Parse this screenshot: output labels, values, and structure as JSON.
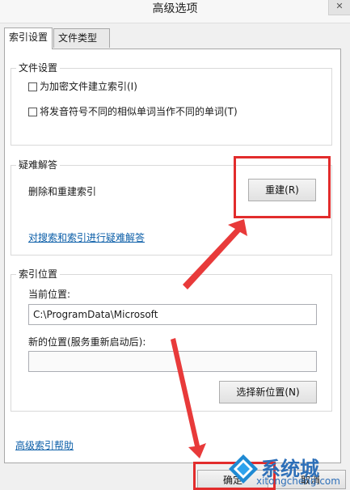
{
  "window": {
    "title": "高级选项"
  },
  "tabs": [
    {
      "label": "索引设置"
    },
    {
      "label": "文件类型"
    }
  ],
  "file_settings": {
    "title": "文件设置",
    "options": [
      {
        "label": "为加密文件建立索引(I)"
      },
      {
        "label": "将发音符号不同的相似单词当作不同的单词(T)"
      }
    ]
  },
  "troubleshoot": {
    "title": "疑难解答",
    "description": "删除和重建索引",
    "rebuild_label": "重建(R)",
    "link_label": "对搜索和索引进行疑难解答"
  },
  "index_location": {
    "title": "索引位置",
    "current_label": "当前位置:",
    "current_value": "C:\\ProgramData\\Microsoft",
    "new_label": "新的位置(服务重新启动后):",
    "new_value": "",
    "select_label": "选择新位置(N)"
  },
  "help_link": "高级索引帮助",
  "footer": {
    "ok_label": "确定",
    "cancel_label": "取消"
  },
  "watermark": {
    "text": "系统城",
    "sub": "xitongcheng.com"
  }
}
